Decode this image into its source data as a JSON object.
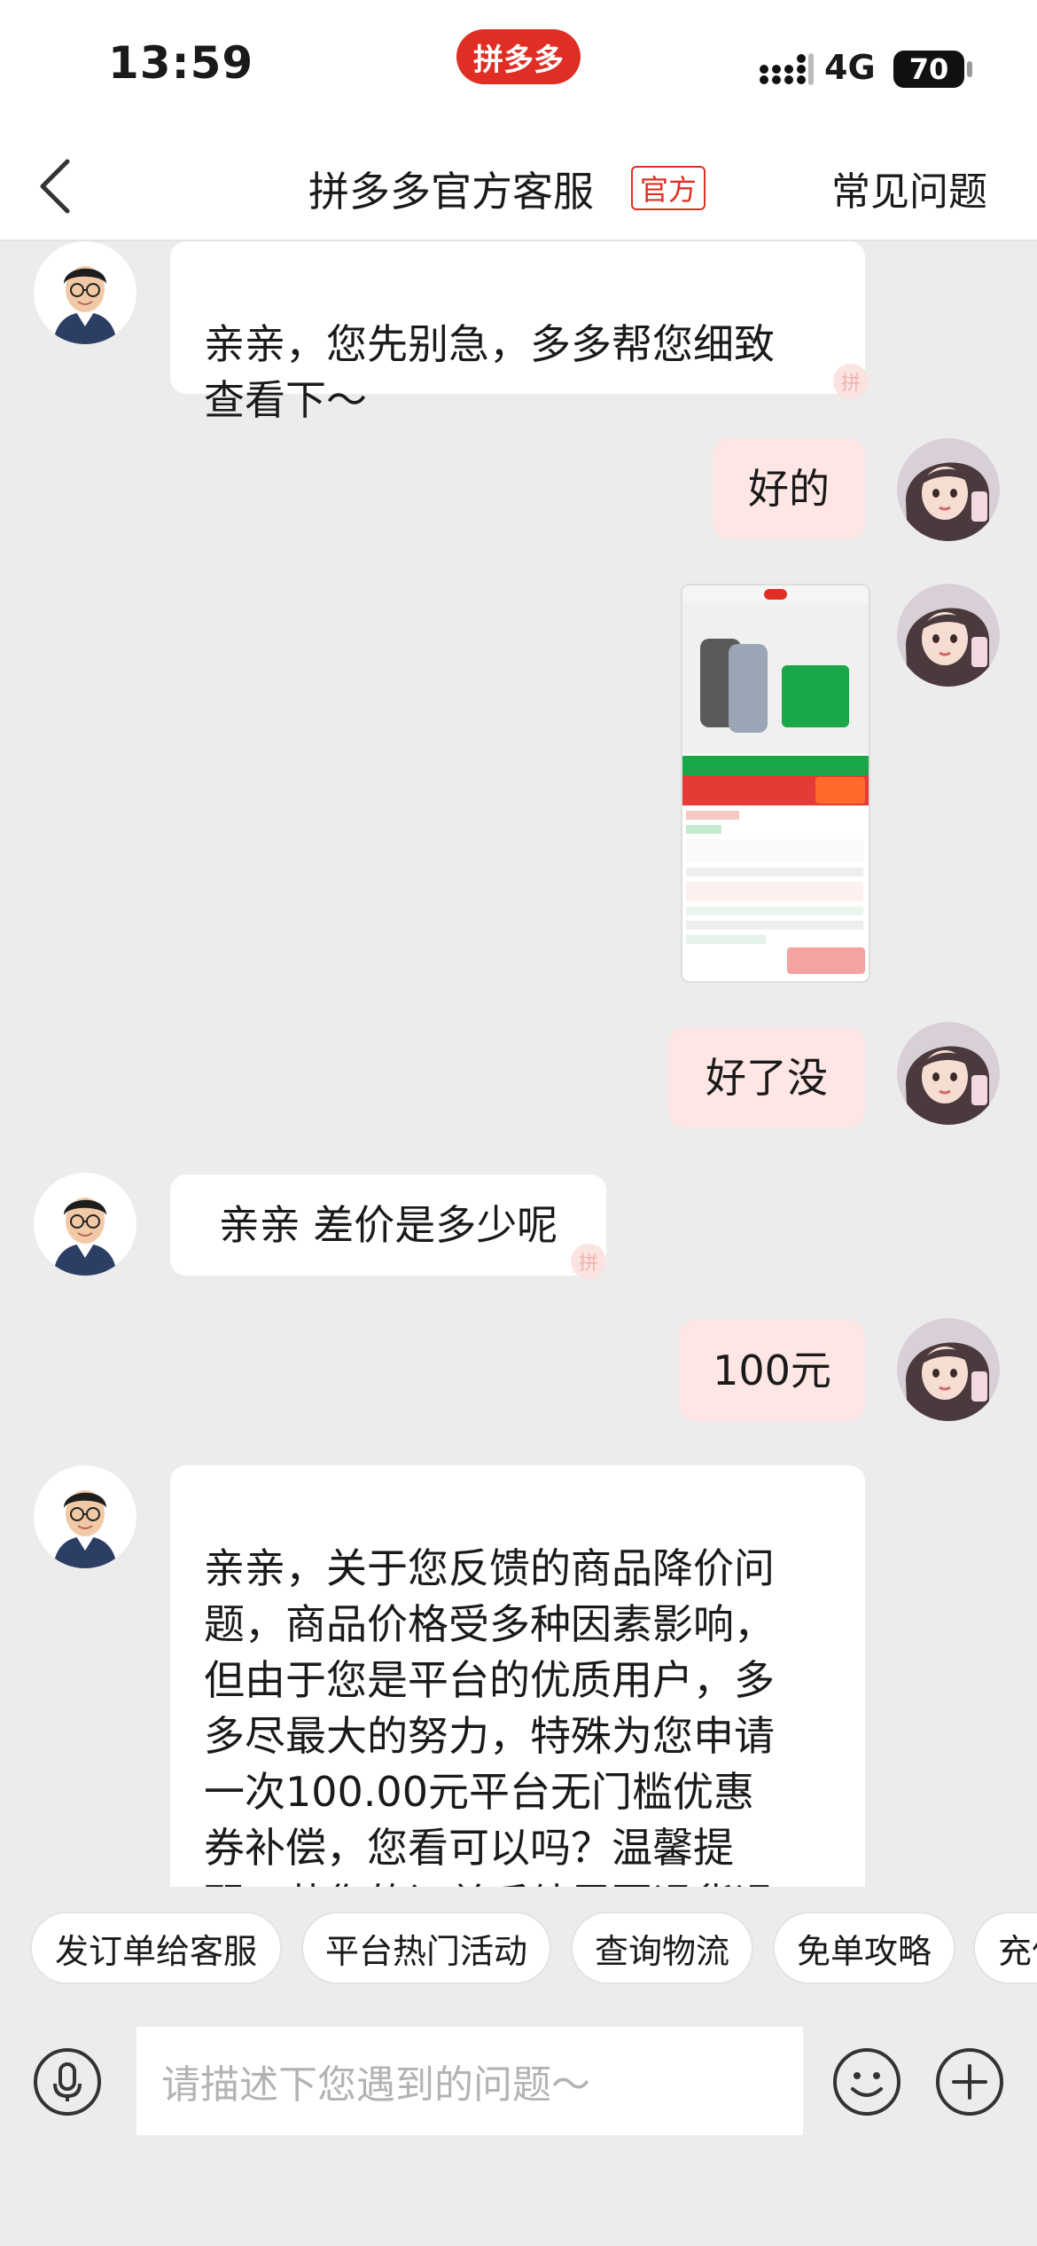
{
  "status_bar": {
    "time": "13:59",
    "brand": "拼多多",
    "network": "4G",
    "battery": "70"
  },
  "nav": {
    "title": "拼多多官方客服",
    "tag": "官方",
    "faq": "常见问题"
  },
  "colors": {
    "brand_red": "#e02e24",
    "agent_bubble": "#ffffff",
    "user_bubble": "#fde6e4",
    "chat_background": "#ececec"
  },
  "messages": [
    {
      "from": "agent",
      "text": "亲亲，您先别急，多多帮您细致\n查看下～"
    },
    {
      "from": "user",
      "text": "好的"
    },
    {
      "from": "user",
      "type": "image",
      "image_desc_icon": "product-screenshot"
    },
    {
      "from": "user",
      "text": "好了没"
    },
    {
      "from": "agent",
      "text": "亲亲 差价是多少呢"
    },
    {
      "from": "user",
      "text": "100元"
    },
    {
      "from": "agent",
      "text": "亲亲，关于您反馈的商品降价问\n题，商品价格受多种因素影响，\n但由于您是平台的优质用户，多\n多尽最大的努力，特殊为您申请\n一次100.00元平台无门槛优惠\n券补偿，您看可以吗？温馨提\n醒：若您的订单后续需要退货退"
    }
  ],
  "quick_replies": [
    "发订单给客服",
    "平台热门活动",
    "查询物流",
    "免单攻略",
    "充值"
  ],
  "input": {
    "placeholder": "请描述下您遇到的问题～"
  }
}
